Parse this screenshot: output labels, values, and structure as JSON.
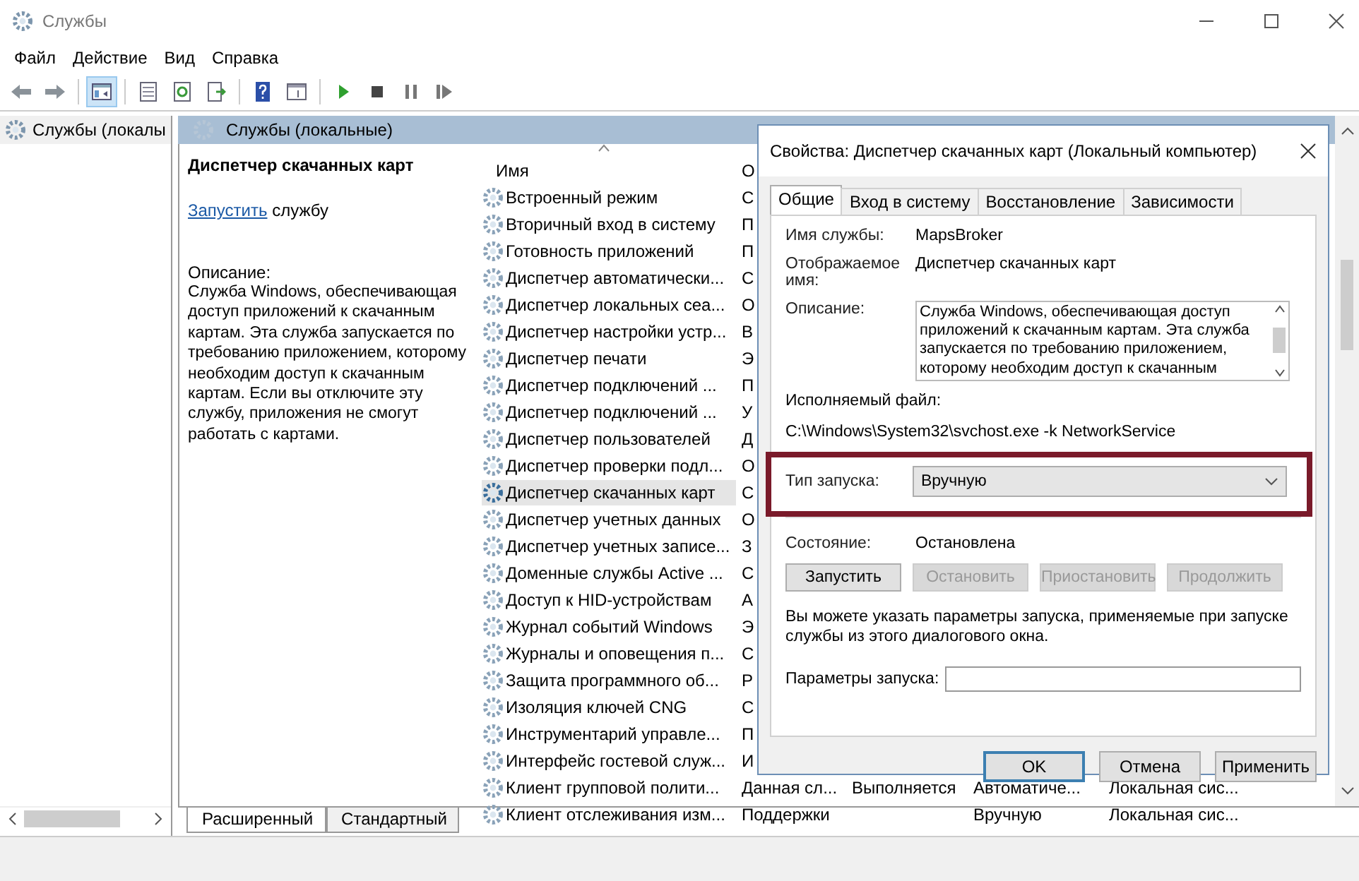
{
  "window": {
    "title": "Службы"
  },
  "menu": [
    "Файл",
    "Действие",
    "Вид",
    "Справка"
  ],
  "toolbar": {
    "groups": [
      [
        {
          "kind": "back",
          "pressed": false
        },
        {
          "kind": "forward",
          "pressed": false
        }
      ],
      [
        {
          "kind": "console-tree",
          "pressed": true
        }
      ],
      [
        {
          "kind": "properties",
          "pressed": false
        },
        {
          "kind": "refresh",
          "pressed": false
        },
        {
          "kind": "export",
          "pressed": false
        }
      ],
      [
        {
          "kind": "help",
          "pressed": false
        },
        {
          "kind": "view",
          "pressed": false
        }
      ],
      [
        {
          "kind": "start",
          "pressed": false
        },
        {
          "kind": "stop",
          "pressed": false
        },
        {
          "kind": "pause",
          "pressed": false
        },
        {
          "kind": "resume",
          "pressed": false
        }
      ]
    ]
  },
  "tree": {
    "items": [
      {
        "label": "Службы (локалы",
        "selected": true
      }
    ]
  },
  "panel": {
    "title": "Службы (локальные)"
  },
  "details": {
    "title": "Диспетчер скачанных карт",
    "action_link": "Запустить",
    "action_text": "службу",
    "description_label": "Описание:",
    "description": "Служба Windows, обеспечивающая доступ приложений к скачанным картам. Эта служба запускается по требованию приложением, которому необходим доступ к скачанным картам. Если вы отключите эту службу, приложения не смогут работать с картами."
  },
  "list": {
    "columns": [
      "Имя",
      "О"
    ],
    "rows": [
      {
        "name": "Встроенный режим",
        "column_2": "С",
        "selected": false
      },
      {
        "name": "Вторичный вход в систему",
        "column_2": "П",
        "selected": false
      },
      {
        "name": "Готовность приложений",
        "column_2": "П",
        "selected": false
      },
      {
        "name": "Диспетчер автоматически...",
        "column_2": "С",
        "selected": false
      },
      {
        "name": "Диспетчер локальных сеа...",
        "column_2": "О",
        "selected": false
      },
      {
        "name": "Диспетчер настройки устр...",
        "column_2": "В",
        "selected": false
      },
      {
        "name": "Диспетчер печати",
        "column_2": "Э",
        "selected": false
      },
      {
        "name": "Диспетчер подключений ...",
        "column_2": "П",
        "selected": false
      },
      {
        "name": "Диспетчер подключений ...",
        "column_2": "У",
        "selected": false
      },
      {
        "name": "Диспетчер пользователей",
        "column_2": "Д",
        "selected": false
      },
      {
        "name": "Диспетчер проверки подл...",
        "column_2": "О",
        "selected": false
      },
      {
        "name": "Диспетчер скачанных карт",
        "column_2": "С",
        "selected": true
      },
      {
        "name": "Диспетчер учетных данных",
        "column_2": "О",
        "selected": false
      },
      {
        "name": "Диспетчер учетных записе...",
        "column_2": "З",
        "selected": false
      },
      {
        "name": "Доменные службы Active ...",
        "column_2": "С",
        "selected": false
      },
      {
        "name": "Доступ к HID-устройствам",
        "column_2": "А",
        "selected": false
      },
      {
        "name": "Журнал событий Windows",
        "column_2": "Э",
        "selected": false
      },
      {
        "name": "Журналы и оповещения п...",
        "column_2": "С",
        "selected": false
      },
      {
        "name": "Защита программного об...",
        "column_2": "Р",
        "selected": false
      },
      {
        "name": "Изоляция ключей CNG",
        "column_2": "С",
        "selected": false
      },
      {
        "name": "Инструментарий управле...",
        "column_2": "П",
        "selected": false
      },
      {
        "name": "Интерфейс гостевой служ...",
        "column_2": "И",
        "selected": false
      },
      {
        "name": "Клиент групповой полити...",
        "column_2": "Данная сл...",
        "column_3": "Выполняется",
        "column_4": "Автоматиче...",
        "column_5": "Локальная сис...",
        "selected": false
      },
      {
        "name": "Клиент отслеживания изм...",
        "column_2": "Поддержки",
        "column_4": "Вручную",
        "column_5": "Локальная сис...",
        "selected": false
      }
    ]
  },
  "view_tabs": [
    {
      "label": "Расширенный",
      "selected": true
    },
    {
      "label": "Стандартный",
      "selected": false
    }
  ],
  "dialog": {
    "title": "Свойства: Диспетчер скачанных карт (Локальный компьютер)",
    "tabs": [
      {
        "label": "Общие",
        "selected": true
      },
      {
        "label": "Вход в систему",
        "selected": false
      },
      {
        "label": "Восстановление",
        "selected": false
      },
      {
        "label": "Зависимости",
        "selected": false
      }
    ],
    "service_name_label": "Имя службы:",
    "service_name": "MapsBroker",
    "display_name_label": "Отображаемое имя:",
    "display_name": "Диспетчер скачанных карт",
    "description_label": "Описание:",
    "description": "Служба Windows, обеспечивающая доступ приложений к скачанным картам. Эта служба запускается по требованию приложением, которому необходим доступ к скачанным",
    "executable_label": "Исполняемый файл:",
    "executable": "C:\\Windows\\System32\\svchost.exe -k NetworkService",
    "startup_type_label": "Тип запуска:",
    "startup_type": "Вручную",
    "startup_highlight": true,
    "status_label": "Состояние:",
    "status": "Остановлена",
    "service_buttons": [
      {
        "label": "Запустить",
        "disabled": false
      },
      {
        "label": "Остановить",
        "disabled": true
      },
      {
        "label": "Приостановить",
        "disabled": true
      },
      {
        "label": "Продолжить",
        "disabled": true
      }
    ],
    "hint": "Вы можете указать параметры запуска, применяемые при запуске службы из этого диалогового окна.",
    "parameters_label": "Параметры запуска:",
    "buttons": [
      {
        "label": "OK",
        "default": true
      },
      {
        "label": "Отмена",
        "default": false
      },
      {
        "label": "Применить",
        "default": false
      }
    ]
  }
}
